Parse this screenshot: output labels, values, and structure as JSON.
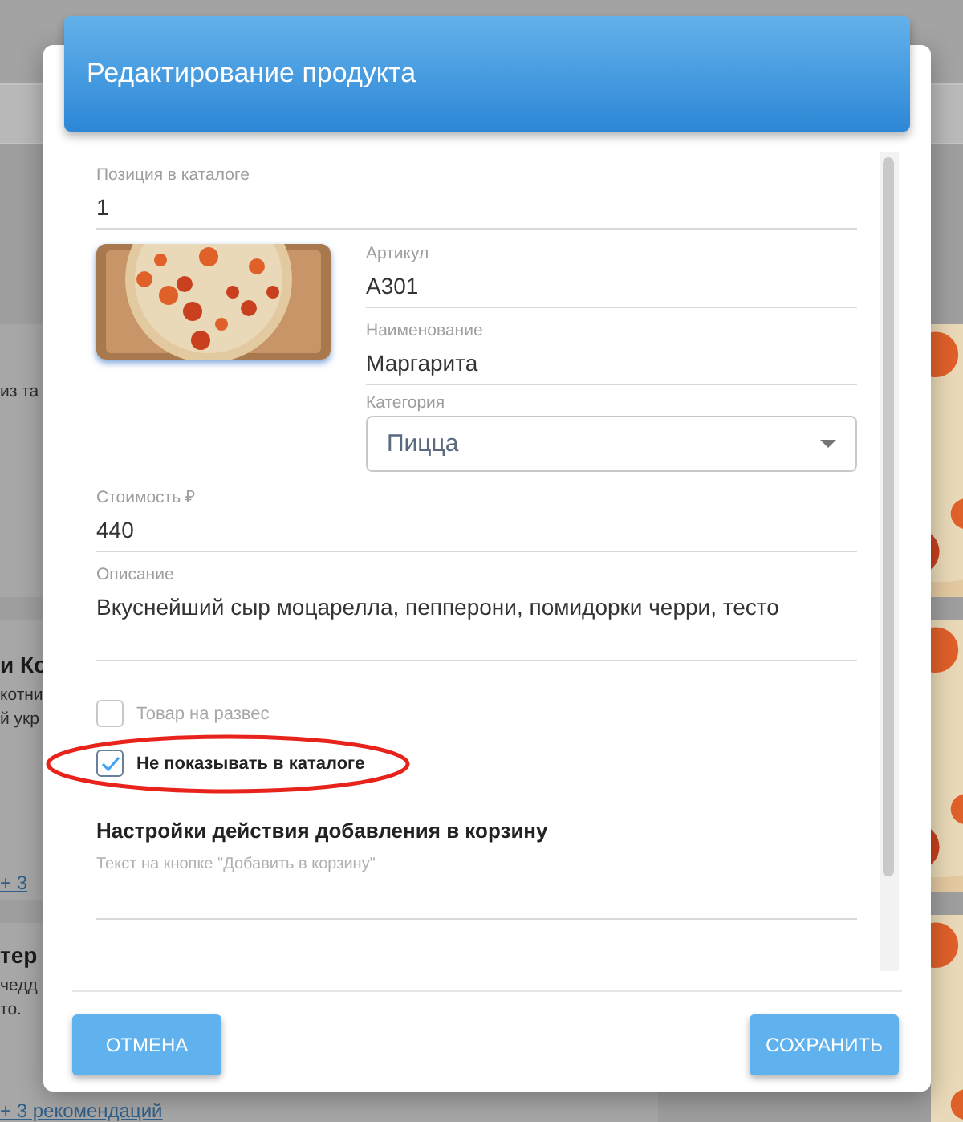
{
  "background": {
    "cards": [
      {
        "lines": [
          {
            "kind": "text",
            "text": "из та"
          }
        ]
      },
      {
        "lines": [
          {
            "kind": "title",
            "text": "и Ко"
          },
          {
            "kind": "text",
            "text": "котни"
          },
          {
            "kind": "text",
            "text": "й укр"
          },
          {
            "kind": "link",
            "text": "+ 3"
          }
        ]
      },
      {
        "lines": [
          {
            "kind": "title",
            "text": "тер"
          },
          {
            "kind": "text",
            "text": "чедд"
          },
          {
            "kind": "text",
            "text": "то."
          },
          {
            "kind": "link",
            "text": "+ 3 рекомендаций"
          }
        ]
      }
    ]
  },
  "dialog": {
    "title": "Редактирование продукта",
    "position": {
      "label": "Позиция в каталоге",
      "value": "1"
    },
    "sku": {
      "label": "Артикул",
      "value": "A301"
    },
    "name": {
      "label": "Наименование",
      "value": "Маргарита"
    },
    "category": {
      "label": "Категория",
      "value": "Пицца"
    },
    "price": {
      "label": "Стоимость ₽",
      "value": "440"
    },
    "description": {
      "label": "Описание",
      "value": "Вкуснейший сыр моцарелла, пепперони, помидорки черри, тесто"
    },
    "checkboxes": [
      {
        "label": "Товар на развес",
        "checked": false,
        "highlighted": false
      },
      {
        "label": "Не показывать в каталоге",
        "checked": true,
        "highlighted": true
      }
    ],
    "section_title": "Настройки действия добавления в корзину",
    "button_text_field": {
      "label": "Текст на кнопке \"Добавить в корзину\""
    },
    "buttons": [
      {
        "label": "ОТМЕНА"
      },
      {
        "label": "СОХРАНИТЬ"
      }
    ]
  }
}
